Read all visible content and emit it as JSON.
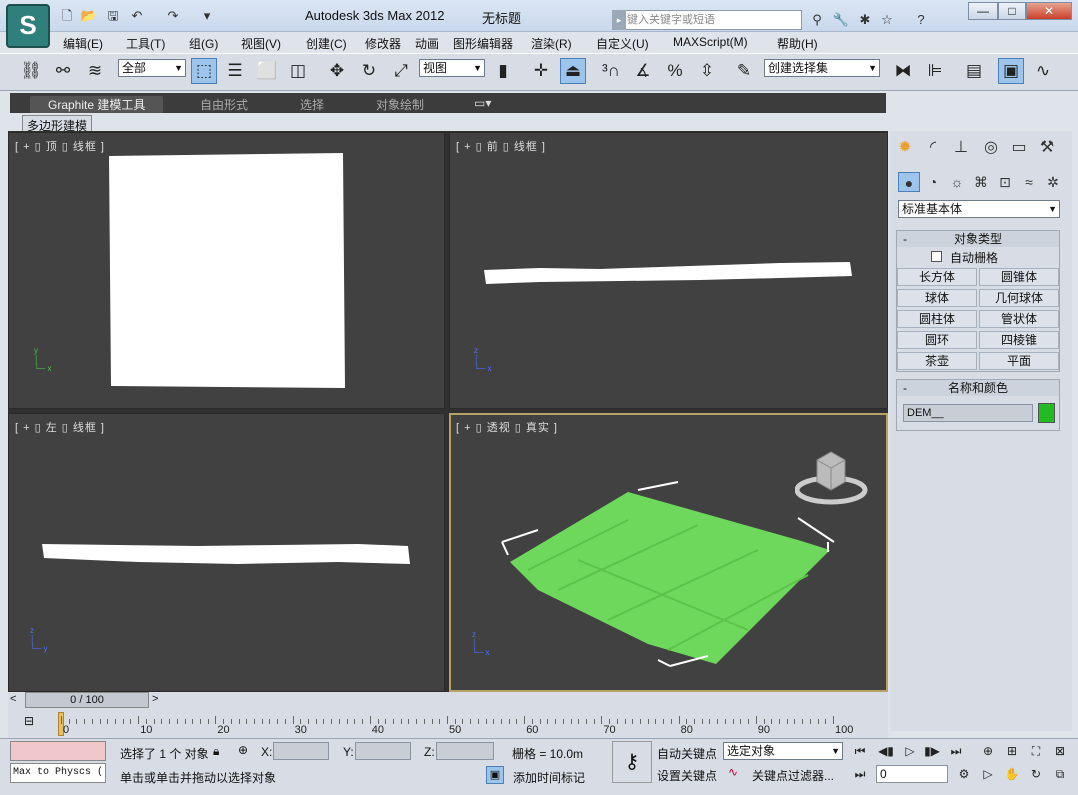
{
  "app": {
    "title": "Autodesk 3ds Max  2012",
    "document": "无标题",
    "logo_letter": "S",
    "search_placeholder": "键入关键字或短语",
    "win_buttons": [
      "—",
      "□",
      "✕"
    ]
  },
  "menu": [
    "编辑(E)",
    "工具(T)",
    "组(G)",
    "视图(V)",
    "创建(C)",
    "修改器",
    "动画",
    "图形编辑器",
    "渲染(R)",
    "自定义(U)",
    "MAXScript(M)",
    "帮助(H)"
  ],
  "toolbar": {
    "filter_value": "全部",
    "ref_coord_value": "视图",
    "selection_set_value": "创建选择集"
  },
  "ribbon": {
    "tabs": [
      "Graphite 建模工具",
      "自由形式",
      "选择",
      "对象绘制"
    ],
    "subtab": "多边形建模"
  },
  "viewports": {
    "top": "[ + ▯ 顶 ▯ 线框 ]",
    "front": "[ + ▯ 前 ▯ 线框 ]",
    "left": "[ + ▯ 左 ▯ 线框 ]",
    "perspective": "[ + ▯ 透视 ▯ 真实 ]"
  },
  "command_panel": {
    "category_value": "标准基本体",
    "object_type_title": "对象类型",
    "autogrid_label": "自动栅格",
    "primitives": [
      "长方体",
      "圆锥体",
      "球体",
      "几何球体",
      "圆柱体",
      "管状体",
      "圆环",
      "四棱锥",
      "茶壶",
      "平面"
    ],
    "name_color_title": "名称和颜色",
    "object_name": "DEM__",
    "object_color": "#22bb22"
  },
  "timeline": {
    "frame_display": "0 / 100",
    "ticks": [
      "0",
      "10",
      "20",
      "30",
      "40",
      "50",
      "60",
      "70",
      "80",
      "90",
      "100"
    ]
  },
  "status": {
    "maxscript_listener": "Max to Physcs (",
    "selection_info": "选择了 1 个 对象",
    "x_label": "X:",
    "y_label": "Y:",
    "z_label": "Z:",
    "grid": "栅格 = 10.0m",
    "prompt": "单击或单击并拖动以选择对象",
    "add_time_tag": "添加时间标记",
    "auto_key": "自动关键点",
    "set_key": "设置关键点",
    "key_mode_value": "选定对象",
    "key_filters": "关键点过滤器...",
    "current_frame": "0"
  }
}
